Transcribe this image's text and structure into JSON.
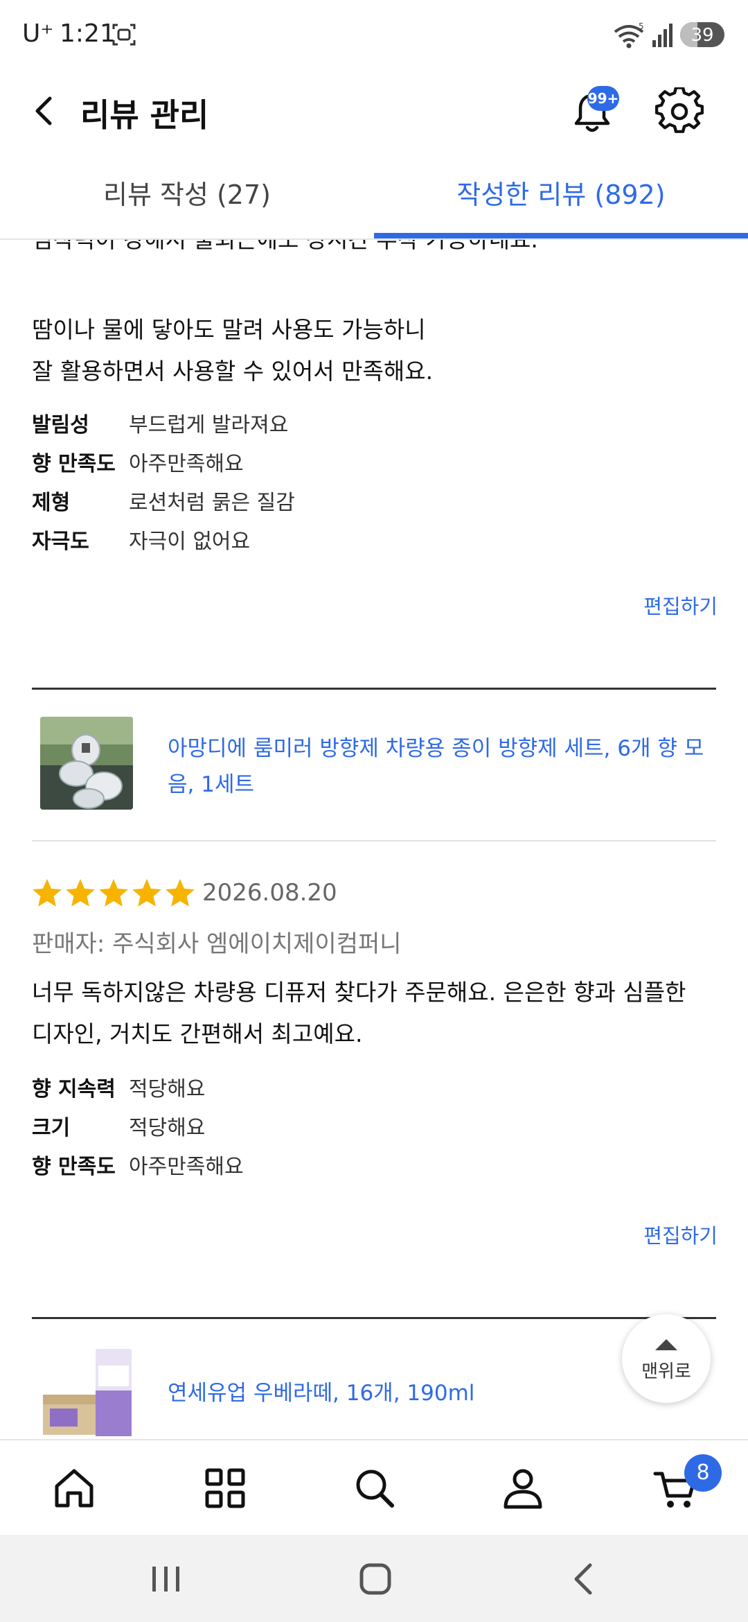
{
  "status_bar": {
    "carrier": "U⁺",
    "time": "1:21",
    "wifi_label": "5",
    "battery": "39",
    "battery_level": 0.39
  },
  "header": {
    "title": "리뷰 관리",
    "notification_badge": "99+"
  },
  "tabs": [
    {
      "label": "리뷰 작성 (27)",
      "active": false
    },
    {
      "label": "작성한 리뷰 (892)",
      "active": true
    }
  ],
  "review_partial": {
    "text_line_cut": "심착력이 강해서 출퇴근에도 장시간 부착 가능하네요.",
    "text_line_1": "땀이나 물에 닿아도 말려 사용도 가능하니",
    "text_line_2": "잘 활용하면서 사용할 수 있어서 만족해요.",
    "attributes": [
      {
        "key": "발림성",
        "value": "부드럽게 발라져요"
      },
      {
        "key": "향 만족도",
        "value": "아주만족해요"
      },
      {
        "key": "제형",
        "value": "로션처럼 묽은 질감"
      },
      {
        "key": "자극도",
        "value": "자극이 없어요"
      }
    ],
    "edit_label": "편집하기"
  },
  "review_2": {
    "product_name": "아망디에 룸미러 방향제 차량용 종이 방향제 세트, 6개 향 모음, 1세트",
    "rating": 5,
    "date": "2026.08.20",
    "seller": "판매자: 주식회사 엠에이치제이컴퍼니",
    "text_line_1": "너무 독하지않은 차량용 디퓨저 찾다가 주문해요. 은은한 향과 심플한",
    "text_line_2": "디자인, 거치도 간편해서 최고예요.",
    "attributes": [
      {
        "key": "향 지속력",
        "value": "적당해요"
      },
      {
        "key": "크기",
        "value": "적당해요"
      },
      {
        "key": "향 만족도",
        "value": "아주만족해요"
      }
    ],
    "edit_label": "편집하기"
  },
  "review_3": {
    "product_name": "연세유업 우베라떼, 16개, 190ml"
  },
  "scroll_top_label": "맨위로",
  "bottom_nav": {
    "items": [
      "home-icon",
      "category-icon",
      "search-icon",
      "account-icon",
      "cart-icon"
    ],
    "cart_badge": "8"
  },
  "colors": {
    "accent": "#2e6ae6",
    "star": "#f6b400"
  }
}
